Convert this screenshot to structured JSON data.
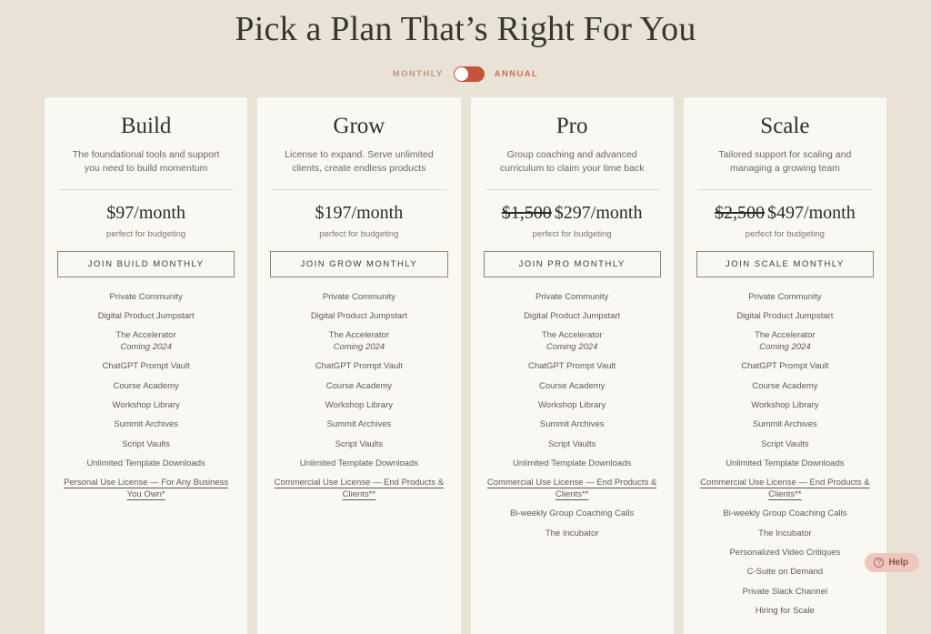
{
  "page": {
    "title": "Pick a Plan That’s Right For You",
    "background_color": "#e9e3d7",
    "card_color": "#faf8f2"
  },
  "billing": {
    "monthly_label": "MONTHLY",
    "annual_label": "ANNUAL",
    "selected": "MONTHLY",
    "accent_color": "#c4553c"
  },
  "plans": [
    {
      "name": "Build",
      "description": "The foundational tools and support you need to build momentum",
      "price_old": "",
      "price": "$97/month",
      "price_note": "perfect for budgeting",
      "cta": "JOIN BUILD MONTHLY",
      "features": [
        {
          "text": "Private Community",
          "note": "",
          "underlined": false
        },
        {
          "text": "Digital Product Jumpstart",
          "note": "",
          "underlined": false
        },
        {
          "text": "The Accelerator",
          "note": "Coming 2024",
          "underlined": false
        },
        {
          "text": "ChatGPT Prompt Vault",
          "note": "",
          "underlined": false
        },
        {
          "text": "Course Academy",
          "note": "",
          "underlined": false
        },
        {
          "text": "Workshop Library",
          "note": "",
          "underlined": false
        },
        {
          "text": "Summit Archives",
          "note": "",
          "underlined": false
        },
        {
          "text": "Script Vaults",
          "note": "",
          "underlined": false
        },
        {
          "text": "Unlimited Template Downloads",
          "note": "",
          "underlined": false
        },
        {
          "text": "Personal Use License — For Any Business You Own*",
          "note": "",
          "underlined": true
        }
      ]
    },
    {
      "name": "Grow",
      "description": "License to expand. Serve unlimited clients, create endless products",
      "price_old": "",
      "price": "$197/month",
      "price_note": "perfect for budgeting",
      "cta": "JOIN GROW MONTHLY",
      "features": [
        {
          "text": "Private Community",
          "note": "",
          "underlined": false
        },
        {
          "text": "Digital Product Jumpstart",
          "note": "",
          "underlined": false
        },
        {
          "text": "The Accelerator",
          "note": "Coming 2024",
          "underlined": false
        },
        {
          "text": "ChatGPT Prompt Vault",
          "note": "",
          "underlined": false
        },
        {
          "text": "Course Academy",
          "note": "",
          "underlined": false
        },
        {
          "text": "Workshop Library",
          "note": "",
          "underlined": false
        },
        {
          "text": "Summit Archives",
          "note": "",
          "underlined": false
        },
        {
          "text": "Script Vaults",
          "note": "",
          "underlined": false
        },
        {
          "text": "Unlimited Template Downloads",
          "note": "",
          "underlined": false
        },
        {
          "text": "Commercial Use License — End Products & Clients**",
          "note": "",
          "underlined": true
        }
      ]
    },
    {
      "name": "Pro",
      "description": "Group coaching and advanced curriculum to claim your time back",
      "price_old": "$1,500",
      "price": "$297/month",
      "price_note": "perfect for budgeting",
      "cta": "JOIN PRO MONTHLY",
      "features": [
        {
          "text": "Private Community",
          "note": "",
          "underlined": false
        },
        {
          "text": "Digital Product Jumpstart",
          "note": "",
          "underlined": false
        },
        {
          "text": "The Accelerator",
          "note": "Coming 2024",
          "underlined": false
        },
        {
          "text": "ChatGPT Prompt Vault",
          "note": "",
          "underlined": false
        },
        {
          "text": "Course Academy",
          "note": "",
          "underlined": false
        },
        {
          "text": "Workshop Library",
          "note": "",
          "underlined": false
        },
        {
          "text": "Summit Archives",
          "note": "",
          "underlined": false
        },
        {
          "text": "Script Vaults",
          "note": "",
          "underlined": false
        },
        {
          "text": "Unlimited Template Downloads",
          "note": "",
          "underlined": false
        },
        {
          "text": "Commercial Use License — End Products & Clients**",
          "note": "",
          "underlined": true
        },
        {
          "text": "Bi-weekly Group Coaching Calls",
          "note": "",
          "underlined": false
        },
        {
          "text": "The Incubator",
          "note": "",
          "underlined": false
        }
      ]
    },
    {
      "name": "Scale",
      "description": "Tailored support for scaling and managing a growing team",
      "price_old": "$2,500",
      "price": "$497/month",
      "price_note": "perfect for budgeting",
      "cta": "JOIN SCALE MONTHLY",
      "features": [
        {
          "text": "Private Community",
          "note": "",
          "underlined": false
        },
        {
          "text": "Digital Product Jumpstart",
          "note": "",
          "underlined": false
        },
        {
          "text": "The Accelerator",
          "note": "Coming 2024",
          "underlined": false
        },
        {
          "text": "ChatGPT Prompt Vault",
          "note": "",
          "underlined": false
        },
        {
          "text": "Course Academy",
          "note": "",
          "underlined": false
        },
        {
          "text": "Workshop Library",
          "note": "",
          "underlined": false
        },
        {
          "text": "Summit Archives",
          "note": "",
          "underlined": false
        },
        {
          "text": "Script Vaults",
          "note": "",
          "underlined": false
        },
        {
          "text": "Unlimited Template Downloads",
          "note": "",
          "underlined": false
        },
        {
          "text": "Commercial Use License — End Products & Clients**",
          "note": "",
          "underlined": true
        },
        {
          "text": "Bi-weekly Group Coaching Calls",
          "note": "",
          "underlined": false
        },
        {
          "text": "The Incubator",
          "note": "",
          "underlined": false
        },
        {
          "text": "Personalized Video Critiques",
          "note": "",
          "underlined": false
        },
        {
          "text": "C-Suite on Demand",
          "note": "",
          "underlined": false
        },
        {
          "text": "Private Slack Channel",
          "note": "",
          "underlined": false
        },
        {
          "text": "Hiring for Scale",
          "note": "",
          "underlined": false
        }
      ]
    }
  ],
  "help": {
    "label": "Help",
    "icon": "question-mark-circle-icon"
  }
}
